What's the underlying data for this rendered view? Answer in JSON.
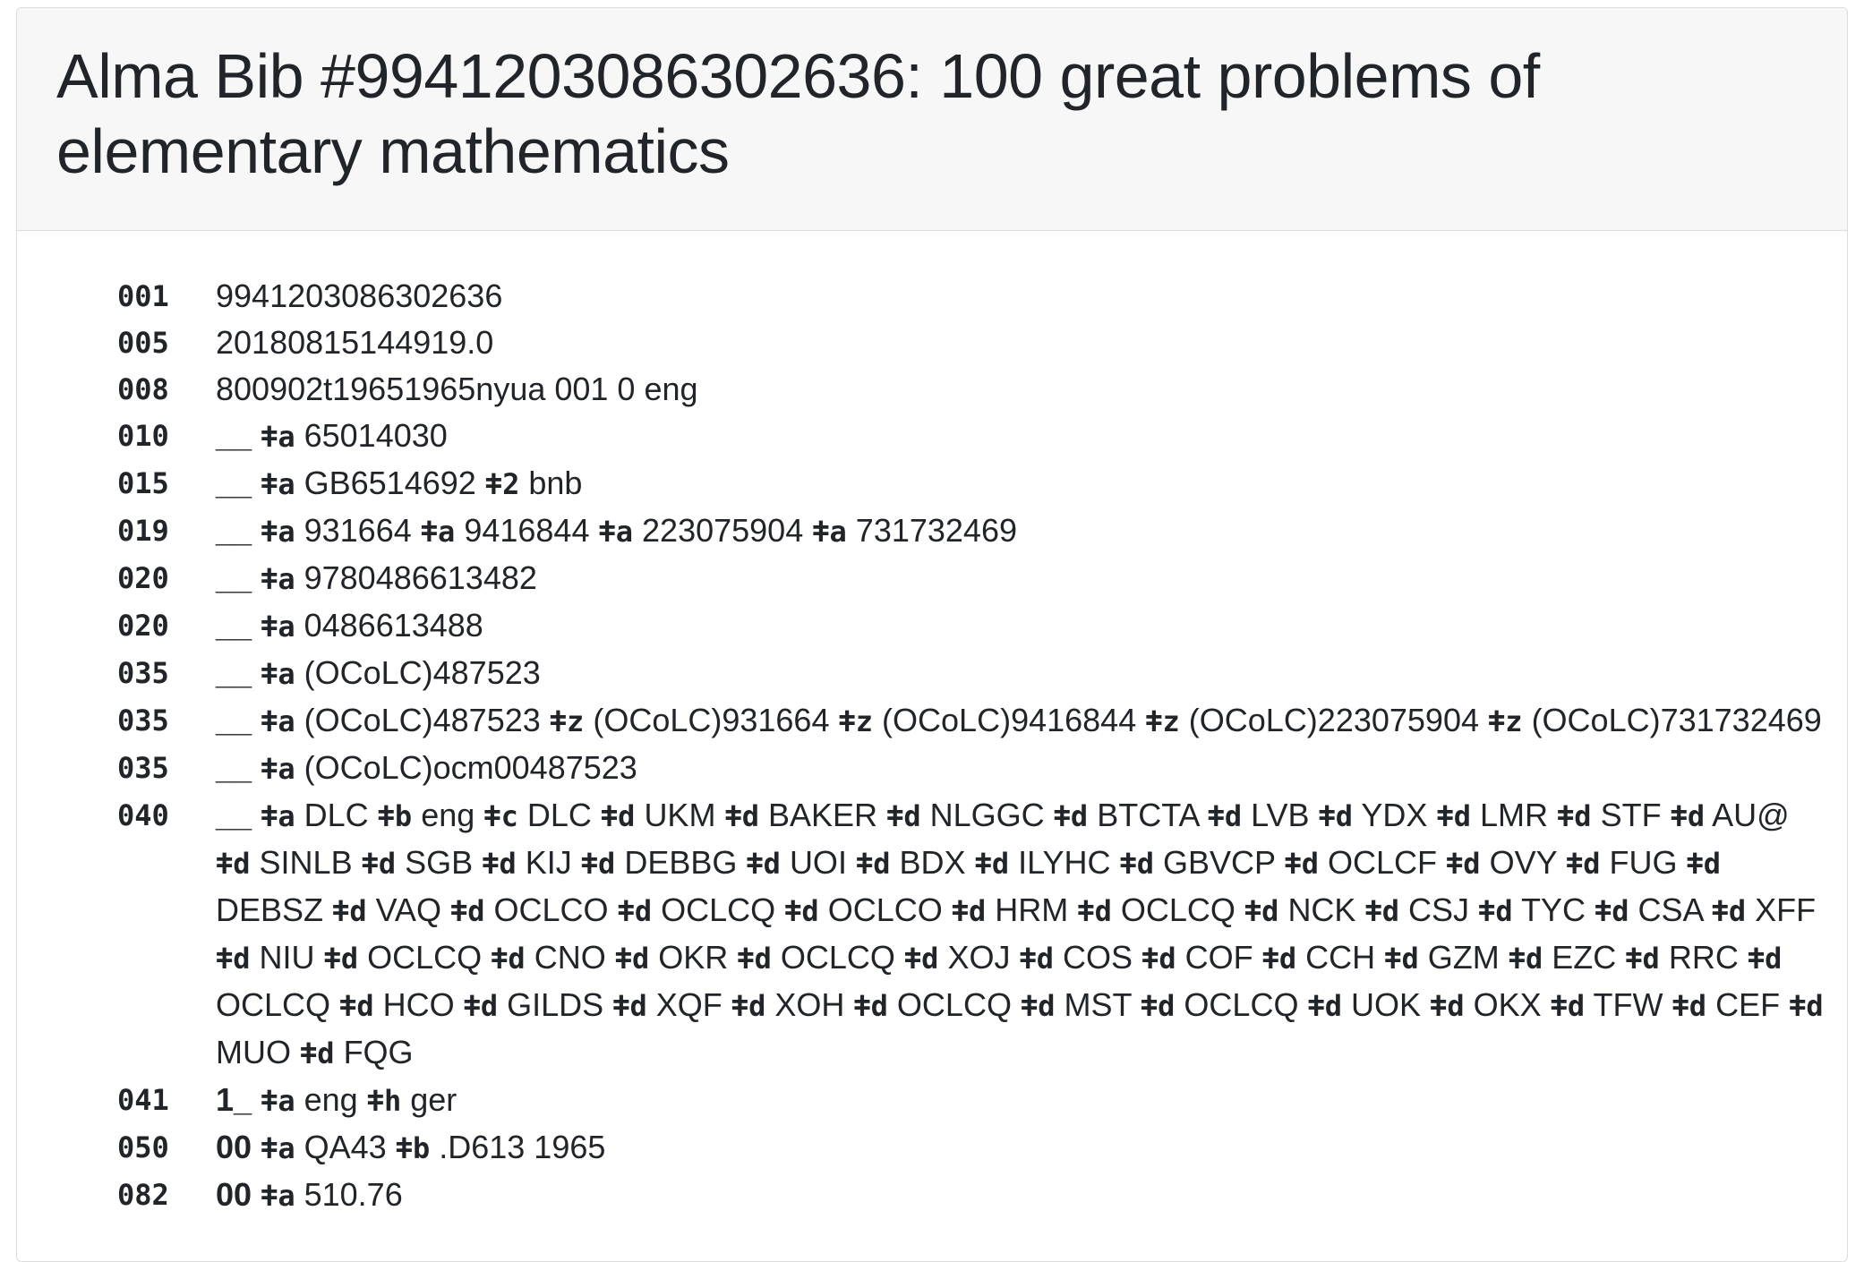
{
  "page": {
    "title": "Alma Bib #9941203086302636: 100 great problems of elementary mathematics"
  },
  "record": {
    "fields": [
      {
        "tag": "001",
        "value": "9941203086302636"
      },
      {
        "tag": "005",
        "value": "20180815144919.0"
      },
      {
        "tag": "008",
        "value": "800902t19651965nyua 001 0 eng"
      },
      {
        "tag": "010",
        "ind": "__",
        "subfields": [
          {
            "code": "a",
            "value": "65014030"
          }
        ]
      },
      {
        "tag": "015",
        "ind": "__",
        "subfields": [
          {
            "code": "a",
            "value": "GB6514692"
          },
          {
            "code": "2",
            "value": "bnb"
          }
        ]
      },
      {
        "tag": "019",
        "ind": "__",
        "subfields": [
          {
            "code": "a",
            "value": "931664"
          },
          {
            "code": "a",
            "value": "9416844"
          },
          {
            "code": "a",
            "value": "223075904"
          },
          {
            "code": "a",
            "value": "731732469"
          }
        ]
      },
      {
        "tag": "020",
        "ind": "__",
        "subfields": [
          {
            "code": "a",
            "value": "9780486613482"
          }
        ]
      },
      {
        "tag": "020",
        "ind": "__",
        "subfields": [
          {
            "code": "a",
            "value": "0486613488"
          }
        ]
      },
      {
        "tag": "035",
        "ind": "__",
        "subfields": [
          {
            "code": "a",
            "value": "(OCoLC)487523"
          }
        ]
      },
      {
        "tag": "035",
        "ind": "__",
        "subfields": [
          {
            "code": "a",
            "value": "(OCoLC)487523"
          },
          {
            "code": "z",
            "value": "(OCoLC)931664"
          },
          {
            "code": "z",
            "value": "(OCoLC)9416844"
          },
          {
            "code": "z",
            "value": "(OCoLC)223075904"
          },
          {
            "code": "z",
            "value": "(OCoLC)731732469"
          }
        ]
      },
      {
        "tag": "035",
        "ind": "__",
        "subfields": [
          {
            "code": "a",
            "value": "(OCoLC)ocm00487523"
          }
        ]
      },
      {
        "tag": "040",
        "ind": "__",
        "subfields": [
          {
            "code": "a",
            "value": "DLC"
          },
          {
            "code": "b",
            "value": "eng"
          },
          {
            "code": "c",
            "value": "DLC"
          },
          {
            "code": "d",
            "value": "UKM"
          },
          {
            "code": "d",
            "value": "BAKER"
          },
          {
            "code": "d",
            "value": "NLGGC"
          },
          {
            "code": "d",
            "value": "BTCTA"
          },
          {
            "code": "d",
            "value": "LVB"
          },
          {
            "code": "d",
            "value": "YDX"
          },
          {
            "code": "d",
            "value": "LMR"
          },
          {
            "code": "d",
            "value": "STF"
          },
          {
            "code": "d",
            "value": "AU@"
          },
          {
            "code": "d",
            "value": "SINLB"
          },
          {
            "code": "d",
            "value": "SGB"
          },
          {
            "code": "d",
            "value": "KIJ"
          },
          {
            "code": "d",
            "value": "DEBBG"
          },
          {
            "code": "d",
            "value": "UOI"
          },
          {
            "code": "d",
            "value": "BDX"
          },
          {
            "code": "d",
            "value": "ILYHC"
          },
          {
            "code": "d",
            "value": "GBVCP"
          },
          {
            "code": "d",
            "value": "OCLCF"
          },
          {
            "code": "d",
            "value": "OVY"
          },
          {
            "code": "d",
            "value": "FUG"
          },
          {
            "code": "d",
            "value": "DEBSZ"
          },
          {
            "code": "d",
            "value": "VAQ"
          },
          {
            "code": "d",
            "value": "OCLCO"
          },
          {
            "code": "d",
            "value": "OCLCQ"
          },
          {
            "code": "d",
            "value": "OCLCO"
          },
          {
            "code": "d",
            "value": "HRM"
          },
          {
            "code": "d",
            "value": "OCLCQ"
          },
          {
            "code": "d",
            "value": "NCK"
          },
          {
            "code": "d",
            "value": "CSJ"
          },
          {
            "code": "d",
            "value": "TYC"
          },
          {
            "code": "d",
            "value": "CSA"
          },
          {
            "code": "d",
            "value": "XFF"
          },
          {
            "code": "d",
            "value": "NIU"
          },
          {
            "code": "d",
            "value": "OCLCQ"
          },
          {
            "code": "d",
            "value": "CNO"
          },
          {
            "code": "d",
            "value": "OKR"
          },
          {
            "code": "d",
            "value": "OCLCQ"
          },
          {
            "code": "d",
            "value": "XOJ"
          },
          {
            "code": "d",
            "value": "COS"
          },
          {
            "code": "d",
            "value": "COF"
          },
          {
            "code": "d",
            "value": "CCH"
          },
          {
            "code": "d",
            "value": "GZM"
          },
          {
            "code": "d",
            "value": "EZC"
          },
          {
            "code": "d",
            "value": "RRC"
          },
          {
            "code": "d",
            "value": "OCLCQ"
          },
          {
            "code": "d",
            "value": "HCO"
          },
          {
            "code": "d",
            "value": "GILDS"
          },
          {
            "code": "d",
            "value": "XQF"
          },
          {
            "code": "d",
            "value": "XOH"
          },
          {
            "code": "d",
            "value": "OCLCQ"
          },
          {
            "code": "d",
            "value": "MST"
          },
          {
            "code": "d",
            "value": "OCLCQ"
          },
          {
            "code": "d",
            "value": "UOK"
          },
          {
            "code": "d",
            "value": "OKX"
          },
          {
            "code": "d",
            "value": "TFW"
          },
          {
            "code": "d",
            "value": "CEF"
          },
          {
            "code": "d",
            "value": "MUO"
          },
          {
            "code": "d",
            "value": "FQG"
          }
        ]
      },
      {
        "tag": "041",
        "ind": "1_",
        "subfields": [
          {
            "code": "a",
            "value": "eng"
          },
          {
            "code": "h",
            "value": "ger"
          }
        ]
      },
      {
        "tag": "050",
        "ind": "00",
        "subfields": [
          {
            "code": "a",
            "value": "QA43"
          },
          {
            "code": "b",
            "value": ".D613 1965"
          }
        ]
      },
      {
        "tag": "082",
        "ind": "00",
        "subfields": [
          {
            "code": "a",
            "value": "510.76"
          }
        ]
      }
    ]
  }
}
